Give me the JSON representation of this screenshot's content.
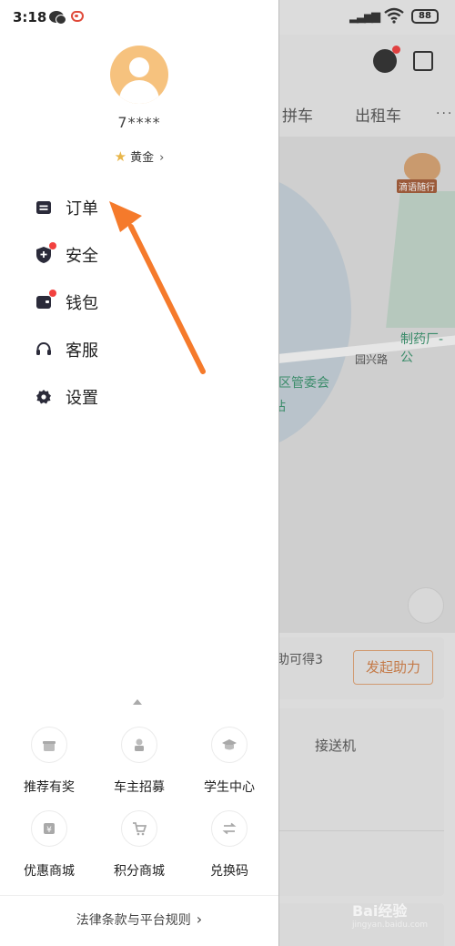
{
  "status_bar": {
    "time": "3:18",
    "battery": "88"
  },
  "profile": {
    "username": "7****",
    "level": "黄金"
  },
  "menu": [
    {
      "label": "订单",
      "icon": "order-icon",
      "badge": false
    },
    {
      "label": "安全",
      "icon": "shield-icon",
      "badge": true
    },
    {
      "label": "钱包",
      "icon": "wallet-icon",
      "badge": true
    },
    {
      "label": "客服",
      "icon": "headset-icon",
      "badge": false
    },
    {
      "label": "设置",
      "icon": "gear-icon",
      "badge": false
    }
  ],
  "grid": [
    {
      "label": "推荐有奖",
      "icon": "gift-icon"
    },
    {
      "label": "车主招募",
      "icon": "driver-icon"
    },
    {
      "label": "学生中心",
      "icon": "graduation-cap-icon"
    },
    {
      "label": "优惠商城",
      "icon": "coupon-icon"
    },
    {
      "label": "积分商城",
      "icon": "cart-icon"
    },
    {
      "label": "兑换码",
      "icon": "exchange-icon"
    }
  ],
  "footer": {
    "legal_link": "法律条款与平台规则"
  },
  "background": {
    "tabs": [
      "拼车",
      "出租车"
    ],
    "map_labels": {
      "poi_1": "制药厂-公",
      "road": "园兴路",
      "poi_2": "区管委会",
      "poi_3": "站",
      "horn_tag": "滴语随行"
    },
    "promo_text": "助可得3",
    "promo_button": "发起助力",
    "service_card": "接送机",
    "watermark": "Bai经验",
    "watermark_sub": "jingyan.baidu.com"
  },
  "colors": {
    "accent_orange": "#f57a2b",
    "badge_red": "#f2413f",
    "avatar_bg": "#f6c27e"
  }
}
